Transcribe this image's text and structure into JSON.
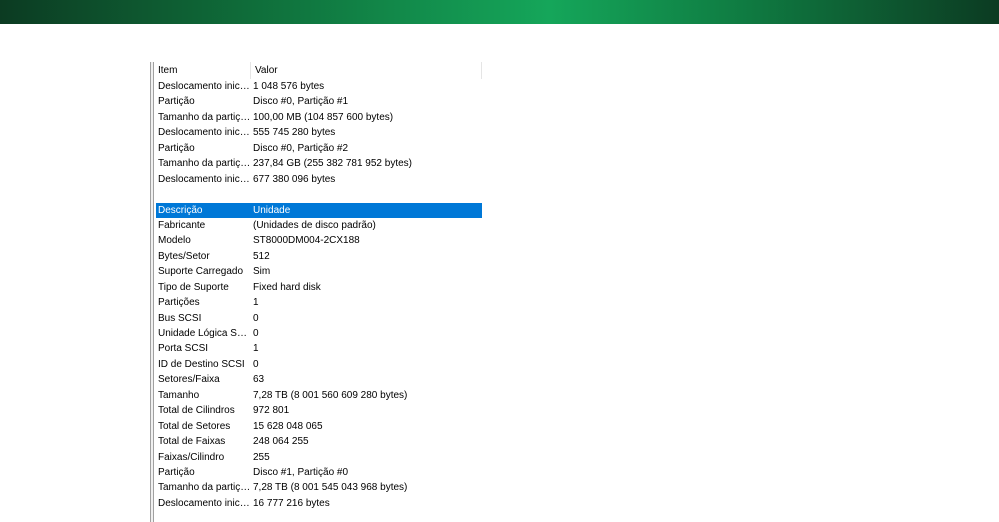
{
  "columns": {
    "item": "Item",
    "value": "Valor"
  },
  "rows": [
    {
      "item": "Deslocamento inicial...",
      "value": "1 048 576 bytes"
    },
    {
      "item": "Partição",
      "value": "Disco #0, Partição #1"
    },
    {
      "item": "Tamanho da partição",
      "value": "100,00 MB (104 857 600 bytes)"
    },
    {
      "item": "Deslocamento inicial...",
      "value": "555 745 280 bytes"
    },
    {
      "item": "Partição",
      "value": "Disco #0, Partição #2"
    },
    {
      "item": "Tamanho da partição",
      "value": "237,84 GB (255 382 781 952 bytes)"
    },
    {
      "item": "Deslocamento inicial...",
      "value": "677 380 096 bytes"
    },
    {
      "item": "",
      "value": ""
    },
    {
      "item": "Descrição",
      "value": "Unidade",
      "selected": true
    },
    {
      "item": "Fabricante",
      "value": "(Unidades de disco padrão)"
    },
    {
      "item": "Modelo",
      "value": "ST8000DM004-2CX188"
    },
    {
      "item": "Bytes/Setor",
      "value": "512"
    },
    {
      "item": "Suporte Carregado",
      "value": "Sim"
    },
    {
      "item": "Tipo de Suporte",
      "value": "Fixed hard disk"
    },
    {
      "item": "Partições",
      "value": "1"
    },
    {
      "item": "Bus SCSI",
      "value": "0"
    },
    {
      "item": "Unidade Lógica SCSI",
      "value": "0"
    },
    {
      "item": "Porta SCSI",
      "value": "1"
    },
    {
      "item": "ID de Destino SCSI",
      "value": "0"
    },
    {
      "item": "Setores/Faixa",
      "value": "63"
    },
    {
      "item": "Tamanho",
      "value": "7,28 TB (8 001 560 609 280 bytes)"
    },
    {
      "item": "Total de Cilindros",
      "value": "972 801"
    },
    {
      "item": "Total de Setores",
      "value": "15 628 048 065"
    },
    {
      "item": "Total de Faixas",
      "value": "248 064 255"
    },
    {
      "item": "Faixas/Cilindro",
      "value": "255"
    },
    {
      "item": "Partição",
      "value": "Disco #1, Partição #0"
    },
    {
      "item": "Tamanho da partição",
      "value": "7,28 TB (8 001 545 043 968 bytes)"
    },
    {
      "item": "Deslocamento inicial...",
      "value": "16 777 216 bytes"
    }
  ]
}
